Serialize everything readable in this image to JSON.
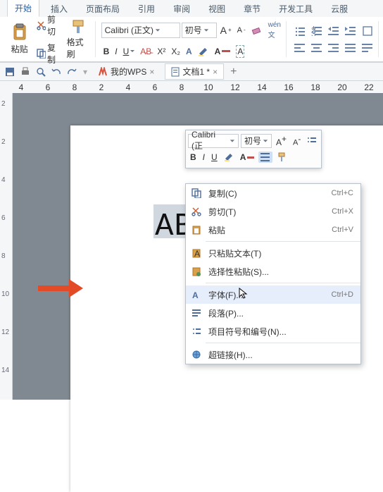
{
  "tabs": {
    "home": "开始",
    "insert": "插入",
    "layout": "页面布局",
    "ref": "引用",
    "review": "审阅",
    "view": "视图",
    "chapter": "章节",
    "dev": "开发工具",
    "cloud": "云服"
  },
  "clipboard": {
    "paste": "粘贴",
    "cut": "剪切",
    "copy": "复制",
    "format": "格式刷"
  },
  "font": {
    "name": "Calibri (正文)",
    "size": "初号",
    "mini_name": "Calibri (正"
  },
  "docs": {
    "mywps": "我的WPS",
    "doc1": "文档1 *"
  },
  "ruler_h": [
    "4",
    "6",
    "8",
    "2",
    "4",
    "6",
    "8",
    "10",
    "12",
    "14",
    "16",
    "18",
    "20",
    "22"
  ],
  "ruler_v": [
    "2",
    "2",
    "4",
    "6",
    "8",
    "10",
    "12",
    "14"
  ],
  "sample": "ABC",
  "ctx": {
    "copy": {
      "l": "复制(C)",
      "s": "Ctrl+C"
    },
    "cut": {
      "l": "剪切(T)",
      "s": "Ctrl+X"
    },
    "paste": {
      "l": "粘贴",
      "s": "Ctrl+V"
    },
    "paste_text": {
      "l": "只粘贴文本(T)",
      "s": ""
    },
    "paste_special": {
      "l": "选择性粘贴(S)...",
      "s": ""
    },
    "font": {
      "l": "字体(F)...",
      "s": "Ctrl+D"
    },
    "para": {
      "l": "段落(P)...",
      "s": ""
    },
    "bullets": {
      "l": "项目符号和编号(N)...",
      "s": ""
    },
    "hyperlink": {
      "l": "超链接(H)...",
      "s": ""
    }
  }
}
